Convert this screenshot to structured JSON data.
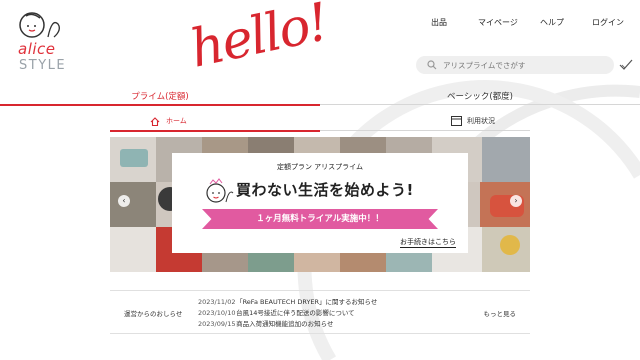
{
  "brand": {
    "logo_top": "alice",
    "logo_bottom": "STYLE",
    "hello": "hello!"
  },
  "topnav": [
    {
      "label": "出品"
    },
    {
      "label": "マイページ"
    },
    {
      "label": "ヘルプ"
    },
    {
      "label": "ログイン"
    }
  ],
  "search": {
    "placeholder": "アリスプライムでさがす"
  },
  "tabs": {
    "premium": "プライム(定額)",
    "basic": "ベーシック(都度)"
  },
  "subnav": {
    "home": "ホーム",
    "usage": "利用状況"
  },
  "banner": {
    "plan_title": "定額プラン アリスプライム",
    "headline": "買わない生活を始めよう!",
    "trial": "１ヶ月無料トライアル実施中！！",
    "apply": "お手続きはこちら"
  },
  "news": {
    "label": "運営からのおしらせ",
    "more": "もっと見る",
    "items": [
      {
        "date": "2023/11/02",
        "title": "「ReFa BEAUTECH DRYER」に関するお知らせ"
      },
      {
        "date": "2023/10/10",
        "title": "台風14号接近に伴う配送の影響について"
      },
      {
        "date": "2023/09/15",
        "title": "商品入荷通知機能追加のお知らせ"
      }
    ]
  },
  "colors": {
    "accent": "#d8262f",
    "pink": "#e15aa0",
    "search_bg": "#efefef"
  }
}
